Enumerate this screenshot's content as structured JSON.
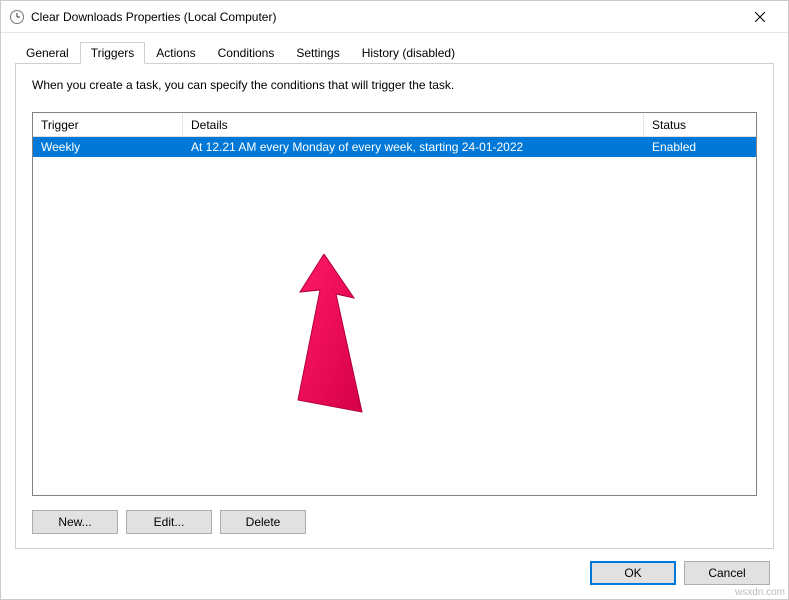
{
  "window": {
    "title": "Clear Downloads Properties (Local Computer)",
    "icon_name": "clock-icon"
  },
  "tabs": [
    {
      "label": "General",
      "active": false
    },
    {
      "label": "Triggers",
      "active": true
    },
    {
      "label": "Actions",
      "active": false
    },
    {
      "label": "Conditions",
      "active": false
    },
    {
      "label": "Settings",
      "active": false
    },
    {
      "label": "History (disabled)",
      "active": false
    }
  ],
  "content": {
    "description": "When you create a task, you can specify the conditions that will trigger the task.",
    "columns": {
      "trigger": "Trigger",
      "details": "Details",
      "status": "Status"
    },
    "rows": [
      {
        "trigger": "Weekly",
        "details": "At 12.21 AM every Monday of every week, starting 24-01-2022",
        "status": "Enabled",
        "selected": true
      }
    ],
    "buttons": {
      "new": "New...",
      "edit": "Edit...",
      "delete": "Delete"
    }
  },
  "footer": {
    "ok": "OK",
    "cancel": "Cancel"
  },
  "colors": {
    "selection": "#0078d7",
    "annotation_arrow": "#ff1a66"
  },
  "watermark": "wsxdn.com"
}
